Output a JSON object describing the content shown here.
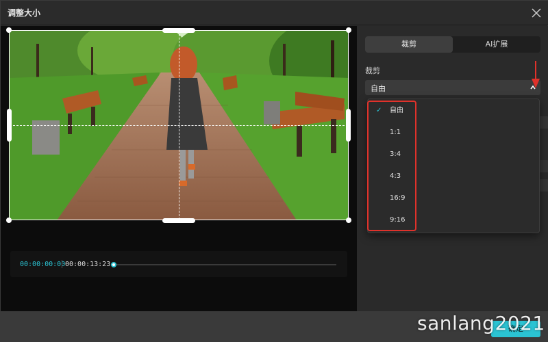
{
  "window": {
    "title": "调整大小"
  },
  "player": {
    "current_time": "00:00:00:00",
    "total_time": "00:00:13:23",
    "progress": 0.0
  },
  "panel": {
    "tabs": [
      {
        "label": "裁剪",
        "active": true
      },
      {
        "label": "AI扩展",
        "active": false
      }
    ],
    "crop_label": "裁剪",
    "selected_ratio": "自由"
  },
  "dropdown": {
    "options": [
      {
        "label": "自由",
        "checked": true
      },
      {
        "label": "1:1",
        "checked": false
      },
      {
        "label": "3:4",
        "checked": false
      },
      {
        "label": "4:3",
        "checked": false
      },
      {
        "label": "16:9",
        "checked": false
      },
      {
        "label": "9:16",
        "checked": false
      }
    ],
    "check_mark": "✓"
  },
  "footer": {
    "ok_label": "确定"
  },
  "watermark": "sanlang2021",
  "colors": {
    "accent": "#2bc3d3",
    "highlight": "#e0322b"
  },
  "icons": {
    "close": "close-icon",
    "chevron": "chevron-up-icon",
    "check": "check-icon"
  }
}
